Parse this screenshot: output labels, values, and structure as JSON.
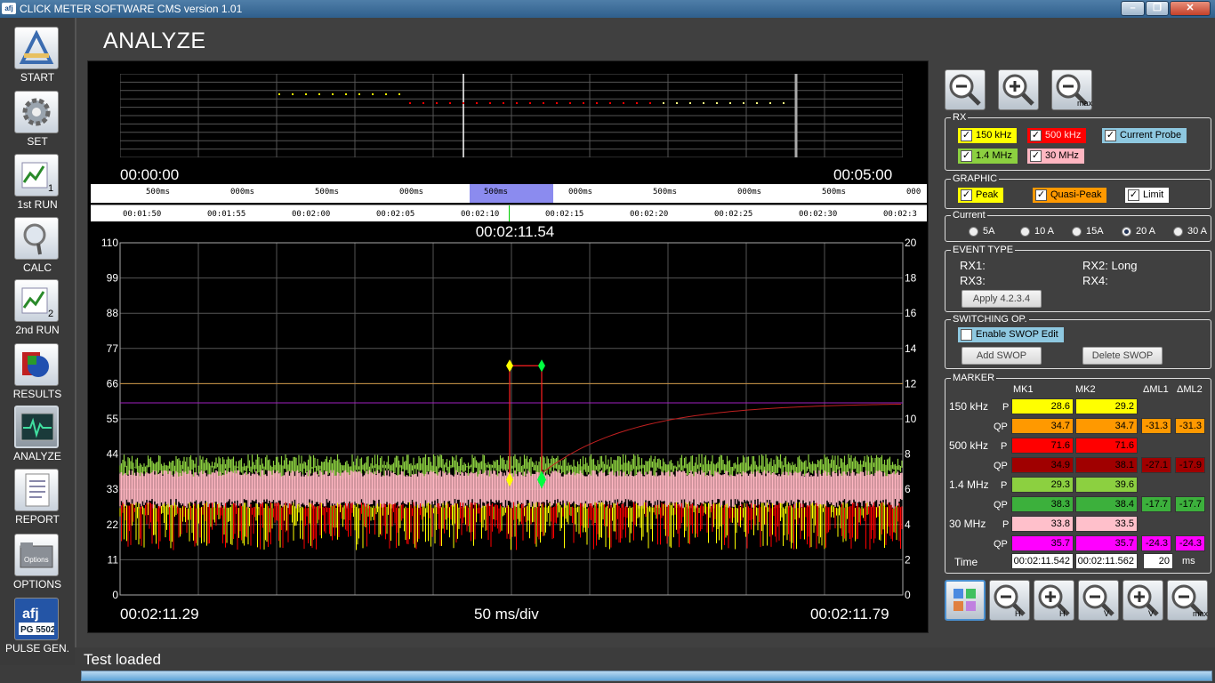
{
  "window": {
    "title": "CLICK METER SOFTWARE CMS version 1.01",
    "app_icon": "afj",
    "min": "–",
    "max": "❐",
    "close": "✕"
  },
  "sidebar": {
    "items": [
      {
        "label": "START",
        "icon": "ruler-pencil-icon"
      },
      {
        "label": "SET",
        "icon": "gear-icon"
      },
      {
        "label": "1st RUN",
        "icon": "chart-run-icon",
        "badge": "1"
      },
      {
        "label": "CALC",
        "icon": "magnifier-icon"
      },
      {
        "label": "2nd RUN",
        "icon": "chart-run-icon",
        "badge": "2"
      },
      {
        "label": "RESULTS",
        "icon": "results-icon"
      },
      {
        "label": "ANALYZE",
        "icon": "oscilloscope-icon"
      },
      {
        "label": "REPORT",
        "icon": "document-icon"
      },
      {
        "label": "OPTIONS",
        "icon": "folder-options-icon",
        "badge": "Options"
      },
      {
        "label": "PULSE GEN.",
        "icon": "afj-pg-icon",
        "logo": "afj",
        "badge": "PG 5502"
      }
    ]
  },
  "page": {
    "title": "ANALYZE"
  },
  "overview": {
    "start": "00:00:00",
    "end": "00:05:00"
  },
  "ruler_ms": [
    "500ms",
    "000ms",
    "500ms",
    "000ms",
    "500ms",
    "000ms",
    "500ms",
    "000ms",
    "500ms",
    "000"
  ],
  "ruler_time": [
    "00:01:50",
    "00:01:55",
    "00:02:00",
    "00:02:05",
    "00:02:10",
    "00:02:15",
    "00:02:20",
    "00:02:25",
    "00:02:30",
    "00:02:3"
  ],
  "cursor_time": "00:02:11.54",
  "plot": {
    "start": "00:02:11.29",
    "end": "00:02:11.79",
    "division": "50 ms/div"
  },
  "chart_data": {
    "type": "line",
    "y_left_ticks": [
      0,
      11,
      22,
      33,
      44,
      55,
      66,
      77,
      88,
      99,
      110
    ],
    "y_right_ticks": [
      0,
      2,
      4,
      6,
      8,
      10,
      12,
      14,
      16,
      18,
      20
    ],
    "ylim_left": [
      0,
      110
    ],
    "ylim_right": [
      0,
      20
    ],
    "grid": true,
    "limit_lines": [
      {
        "value": 60,
        "color": "#a020c0"
      },
      {
        "value": 66,
        "color": "#c89040"
      }
    ],
    "series": [],
    "colors": {
      "rx_150khz": "#ffff00",
      "rx_500khz": "#ff0000",
      "rx_1_4mhz": "#8cd040",
      "rx_30mhz": "#ffb6c1",
      "marker1": "#ffff00",
      "marker2": "#00ff40"
    }
  },
  "zoom_top": [
    {
      "icon": "zoom-out-icon"
    },
    {
      "icon": "zoom-in-icon"
    },
    {
      "icon": "zoom-max-icon",
      "label": "max"
    }
  ],
  "rx": {
    "title": "RX",
    "items": [
      {
        "label": "150 kHz",
        "checked": "✓",
        "bg": "#ffff00",
        "fg": "#000"
      },
      {
        "label": "500 kHz",
        "checked": "✓",
        "bg": "#ff0000",
        "fg": "#fdd"
      },
      {
        "label": "Current Probe",
        "checked": "✓",
        "bg": "#8ec8e0",
        "fg": "#000"
      },
      {
        "label": "1.4 MHz",
        "checked": "✓",
        "bg": "#8cd040",
        "fg": "#000"
      },
      {
        "label": "30 MHz",
        "checked": "✓",
        "bg": "#ffb6c1",
        "fg": "#000"
      }
    ]
  },
  "graphic": {
    "title": "GRAPHIC",
    "items": [
      {
        "label": "Peak",
        "checked": "✓",
        "bg": "#ffff00"
      },
      {
        "label": "Quasi-Peak",
        "checked": "✓",
        "bg": "#ff9900"
      },
      {
        "label": "Limit",
        "checked": "✓",
        "bg": "#ffffff"
      }
    ]
  },
  "current": {
    "title": "Current",
    "options": [
      "5A",
      "10 A",
      "15A",
      "20 A",
      "30 A"
    ],
    "selected": "20 A"
  },
  "event_type": {
    "title": "EVENT TYPE",
    "rx1": "RX1:",
    "rx2": "RX2: Long",
    "rx3": "RX3:",
    "rx4": "RX4:",
    "apply": "Apply 4.2.3.4"
  },
  "switching": {
    "title": "SWITCHING OP.",
    "enable": "Enable SWOP Edit",
    "add": "Add SWOP",
    "delete": "Delete SWOP"
  },
  "marker": {
    "title": "MARKER",
    "headers": [
      "MK1",
      "MK2",
      "ΔML1",
      "ΔML2"
    ],
    "rows": [
      {
        "band": "150 kHz",
        "p": {
          "mk1": "28.6",
          "mk2": "29.2",
          "color": "#ffff00"
        },
        "qp": {
          "mk1": "34.7",
          "mk2": "34.7",
          "d1": "-31.3",
          "d2": "-31.3",
          "color": "#ff9900"
        }
      },
      {
        "band": "500 kHz",
        "p": {
          "mk1": "71.6",
          "mk2": "71.6",
          "color": "#ff0000"
        },
        "qp": {
          "mk1": "34.9",
          "mk2": "38.1",
          "d1": "-27.1",
          "d2": "-17.9",
          "color": "#a00000"
        }
      },
      {
        "band": "1.4 MHz",
        "p": {
          "mk1": "29.3",
          "mk2": "39.6",
          "color": "#8cd040"
        },
        "qp": {
          "mk1": "38.3",
          "mk2": "38.4",
          "d1": "-17.7",
          "d2": "-17.7",
          "color": "#3cb03c"
        }
      },
      {
        "band": "30 MHz",
        "p": {
          "mk1": "33.8",
          "mk2": "33.5",
          "color": "#ffc0cb"
        },
        "qp": {
          "mk1": "35.7",
          "mk2": "35.7",
          "d1": "-24.3",
          "d2": "-24.3",
          "color": "#ff00ff"
        }
      }
    ],
    "p_label": "P",
    "qp_label": "QP",
    "time_label": "Time",
    "time_mk1": "00:02:11.542",
    "time_mk2": "00:02:11.562",
    "time_delta": "20",
    "time_unit": "ms"
  },
  "zoom_bottom": [
    {
      "icon": "palette-icon",
      "label": ""
    },
    {
      "icon": "zoom-out-h-icon",
      "label": "H"
    },
    {
      "icon": "zoom-in-h-icon",
      "label": "H"
    },
    {
      "icon": "zoom-out-v-icon",
      "label": "V"
    },
    {
      "icon": "zoom-in-v-icon",
      "label": "V"
    },
    {
      "icon": "zoom-max-icon",
      "label": "max"
    }
  ],
  "status": {
    "text": "Test loaded",
    "progress": 1.0
  }
}
